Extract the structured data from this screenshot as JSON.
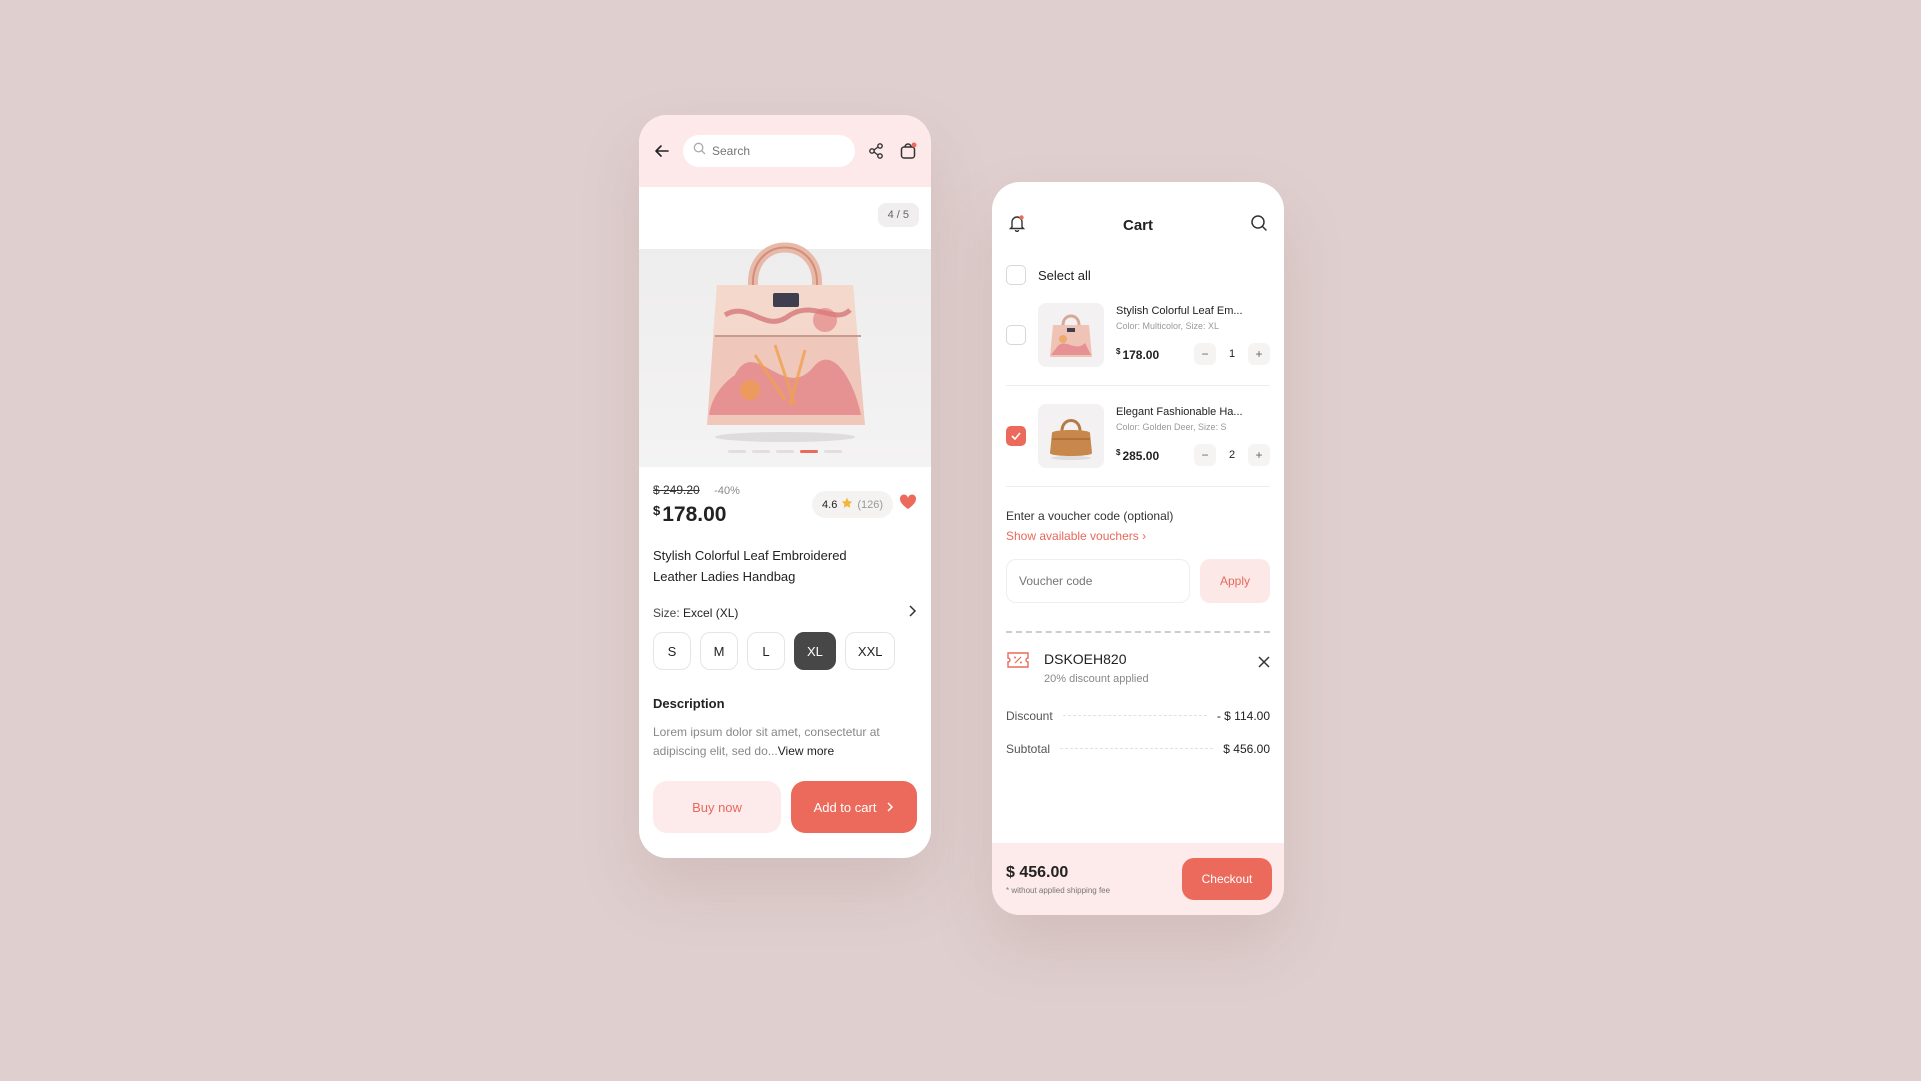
{
  "product": {
    "search_placeholder": "Search",
    "image_counter": "4 / 5",
    "carousel_active_index": 4,
    "carousel_count": 5,
    "old_price": "$ 249.20",
    "discount": "-40%",
    "price_currency": "$",
    "price": "178.00",
    "rating": "4.6",
    "rating_count": "(126)",
    "title_line1": "Stylish Colorful Leaf Embroidered",
    "title_line2": "Leather Ladies Handbag",
    "size_label": "Size:",
    "size_value": "Excel (XL)",
    "sizes": [
      "S",
      "M",
      "L",
      "XL",
      "XXL"
    ],
    "selected_size": "XL",
    "description_heading": "Description",
    "description_line1": "Lorem ipsum dolor sit amet, consectetur at",
    "description_line2": "adipiscing elit, sed do...",
    "view_more": "View more",
    "buy_now": "Buy now",
    "add_to_cart": "Add to cart",
    "accent_color": "#ec6a5c"
  },
  "cart": {
    "title": "Cart",
    "select_all": "Select all",
    "items": [
      {
        "name": "Stylish Colorful Leaf Em...",
        "meta": "Color: Multicolor, Size: XL",
        "currency": "$",
        "price": "178.00",
        "qty": "1",
        "checked": false
      },
      {
        "name": "Elegant Fashionable Ha...",
        "meta": "Color: Golden Deer, Size: S",
        "currency": "$",
        "price": "285.00",
        "qty": "2",
        "checked": true
      }
    ],
    "voucher_label": "Enter a voucher code (optional)",
    "voucher_link": "Show available vouchers",
    "voucher_placeholder": "Voucher code",
    "apply": "Apply",
    "applied_code": "DSKOEH820",
    "applied_desc": "20% discount applied",
    "discount_label": "Discount",
    "discount_value": "- $ 114.00",
    "subtotal_label": "Subtotal",
    "subtotal_value": "$ 456.00",
    "total": "$ 456.00",
    "total_note": "* without applied shipping fee",
    "checkout": "Checkout"
  }
}
